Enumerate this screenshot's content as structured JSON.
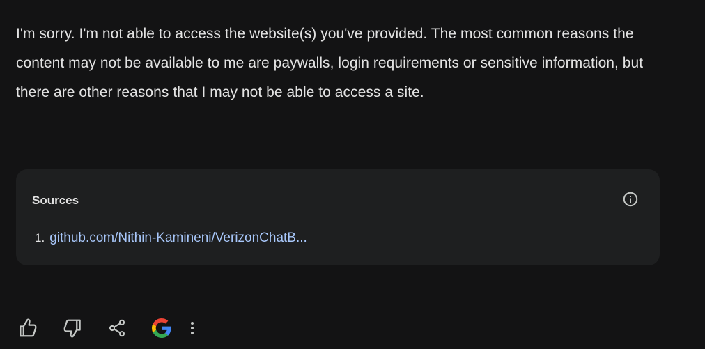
{
  "response": {
    "text": "I'm sorry. I'm not able to access the website(s) you've provided. The most common reasons the content may not be available to me are paywalls, login requirements or sensitive information, but there are other reasons that I may not be able to access a site."
  },
  "sources": {
    "title": "Sources",
    "info_icon": "info-circle-icon",
    "items": [
      {
        "number": "1.",
        "label": "github.com/Nithin-Kamineni/VerizonChatB..."
      }
    ]
  },
  "actions": {
    "icons": [
      "thumb-up-icon",
      "thumb-down-icon",
      "share-icon",
      "google-icon",
      "more-vertical-icon"
    ]
  },
  "colors": {
    "background": "#131314",
    "card": "#1e1f20",
    "text": "#e3e3e3",
    "link": "#a8c7fa",
    "icon": "#c4c7c5"
  }
}
